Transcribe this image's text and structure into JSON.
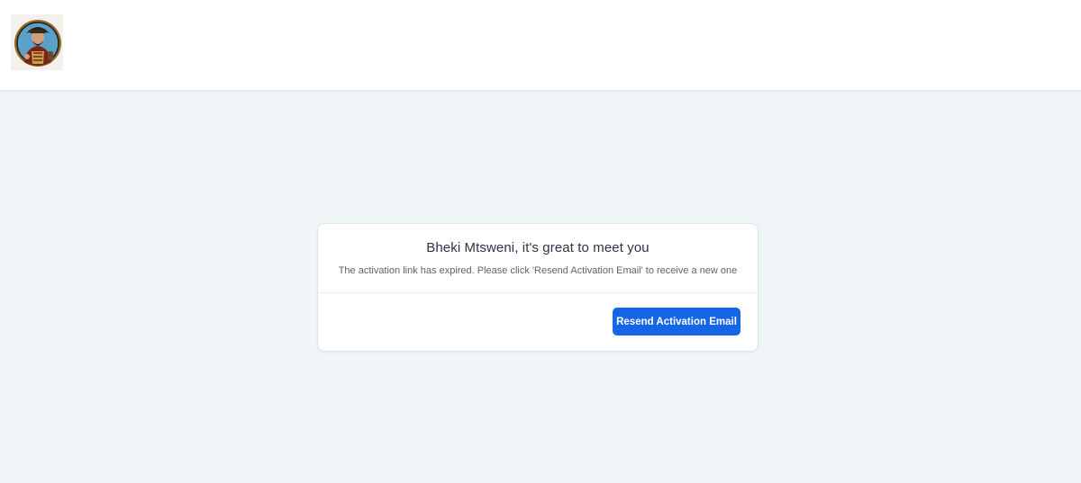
{
  "header": {
    "logo_icon": "pirate-captain-avatar-icon"
  },
  "card": {
    "title": "Bheki Mtsweni, it's great to meet you",
    "message": "The activation link has expired. Please click 'Resend Activation Email' to receive a new one",
    "resend_button_label": "Resend Activation Email"
  },
  "colors": {
    "page_background": "#f0f5f8",
    "primary_button": "#1565e6"
  }
}
